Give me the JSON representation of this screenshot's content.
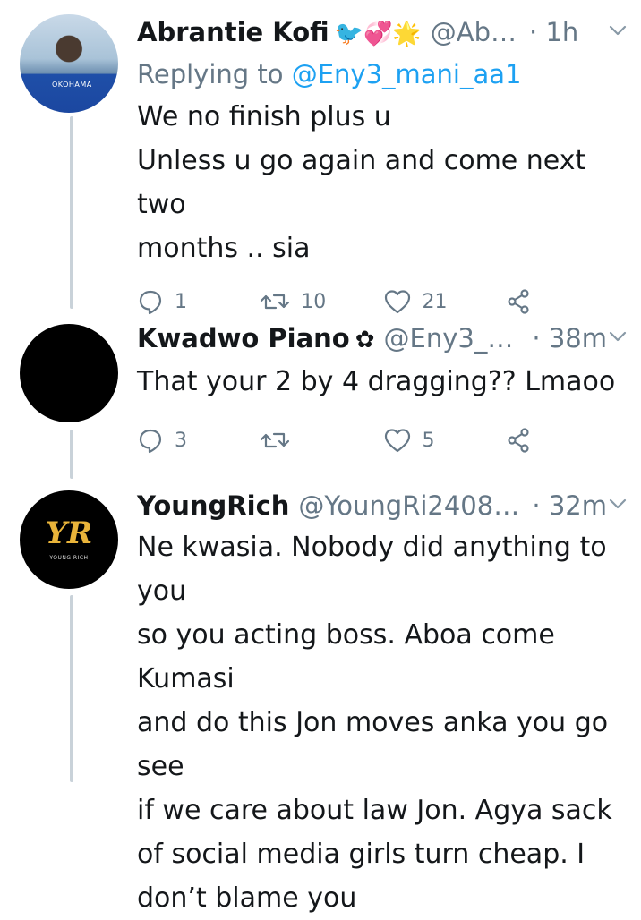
{
  "tweets": [
    {
      "display_name": "Abrantie Kofi",
      "badges": "🐦💞🌟",
      "handle": "@Ab…",
      "time": "· 1h",
      "replying_prefix": "Replying to",
      "replying_to": "@Eny3_mani_aa1",
      "text_lines": [
        "We no finish plus u",
        "Unless u go again and come next two",
        "months .. sia"
      ],
      "reply_count": "1",
      "retweet_count": "10",
      "like_count": "21"
    },
    {
      "display_name": "Kwadwo Piano",
      "badges": "✿",
      "handle": "@Eny3_m…",
      "time": "· 38m",
      "text_lines": [
        "That your 2 by 4 dragging?? Lmaoo"
      ],
      "reply_count": "3",
      "retweet_count": "",
      "like_count": "5"
    },
    {
      "display_name": "YoungRich",
      "badges": "",
      "handle": "@YoungRi24089…",
      "time": "· 32m",
      "text_lines": [
        "Ne kwasia. Nobody did anything to you",
        "so you acting boss. Aboa come Kumasi",
        "and do this Jon moves anka you go see",
        "if we care about law Jon. Agya sack",
        "of social media girls turn cheap. I",
        "don’t blame you"
      ],
      "avatar_mark": "YR",
      "avatar_caption": "YOUNG RICH"
    }
  ],
  "avatar_shirt_text": "OKOHAMA"
}
